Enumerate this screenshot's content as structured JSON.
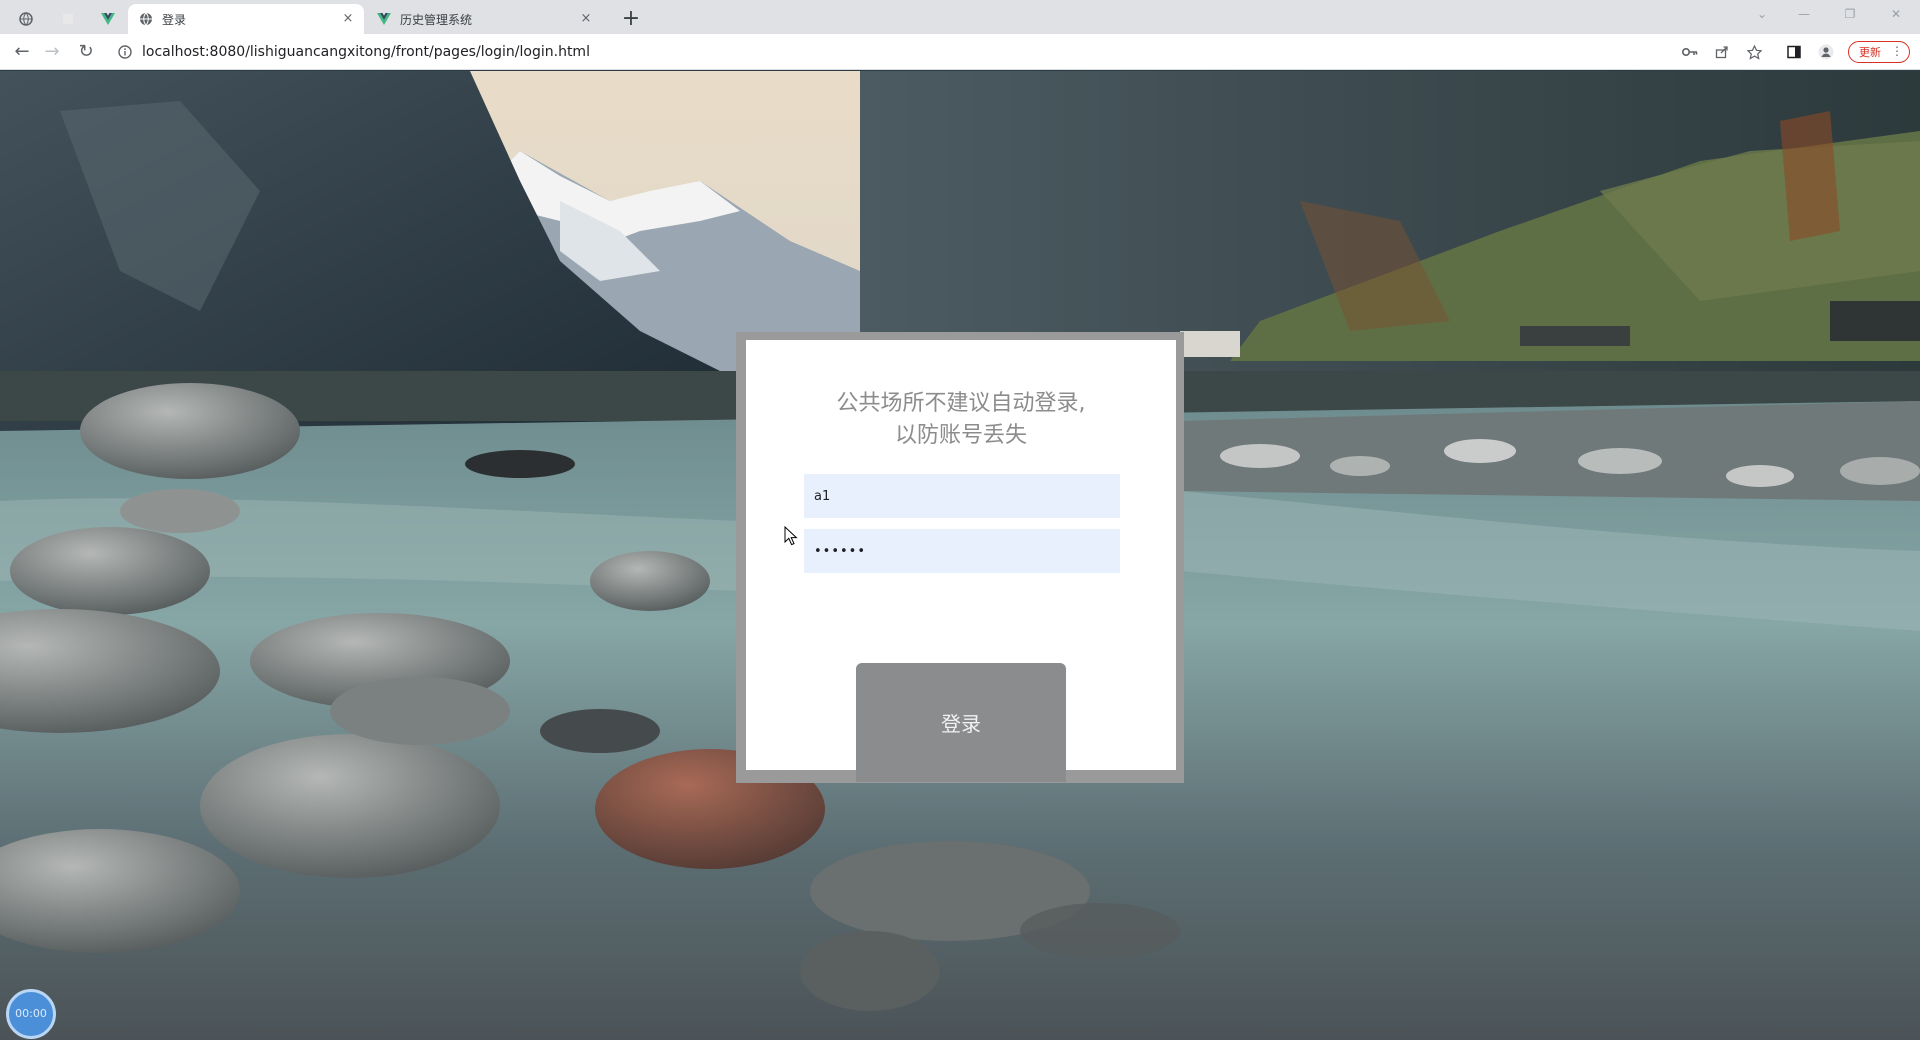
{
  "browser": {
    "tabs": [
      {
        "kind": "pinned",
        "icon": "globe-icon",
        "title": ""
      },
      {
        "kind": "pinned",
        "icon": "blank-icon",
        "title": ""
      },
      {
        "kind": "pinned",
        "icon": "vue-logo-icon",
        "title": ""
      },
      {
        "kind": "active",
        "icon": "globe-icon",
        "title": "登录",
        "close": "×"
      },
      {
        "kind": "normal",
        "icon": "vue-logo-icon",
        "title": "历史管理系统",
        "close": "×"
      }
    ],
    "new_tab": "+",
    "address": "localhost:8080/lishiguancangxitong/front/pages/login/login.html",
    "update_label": "更新",
    "menu_dots": "⋮"
  },
  "login": {
    "title_line1": "公共场所不建议自动登录,",
    "title_line2": "以防账号丢失",
    "username_value": "a1",
    "password_value": "••••••",
    "submit_label": "登录"
  },
  "badge": {
    "label": "00:00"
  },
  "colors": {
    "field_bg": "#e8f0fe",
    "button_bg": "#8a8c8e",
    "card_frame": "#9a9a9a",
    "update_red": "#d93025"
  }
}
